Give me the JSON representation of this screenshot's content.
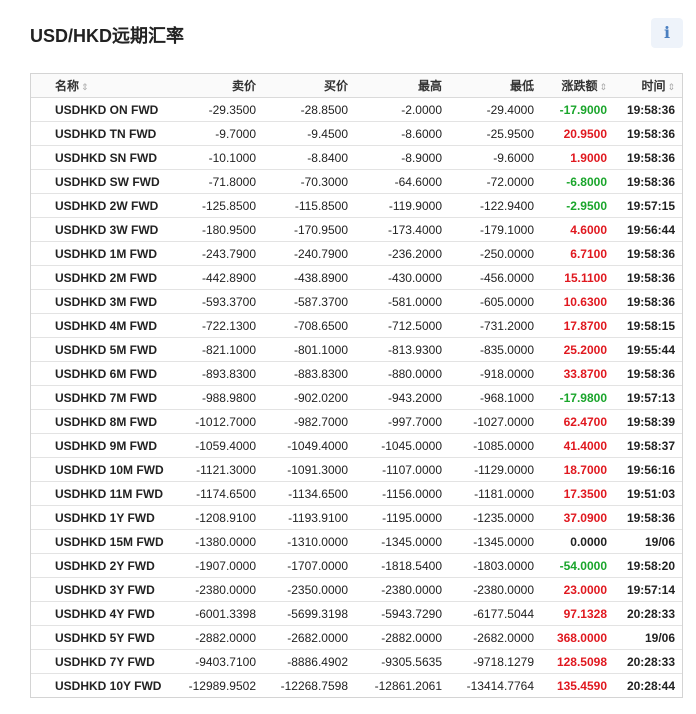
{
  "page": {
    "title": "USD/HKD远期汇率"
  },
  "header": {
    "columns": [
      "名称",
      "卖价",
      "买价",
      "最高",
      "最低",
      "涨跌额",
      "时间"
    ]
  },
  "icons": {
    "sort": "sort-updown-icon",
    "info": "info-icon"
  },
  "colors": {
    "up": "#e0181f",
    "down": "#1aa52b",
    "flat": "#222222"
  },
  "rows": [
    {
      "name": "USDHKD ON FWD",
      "ask": "-29.3500",
      "bid": "-28.8500",
      "high": "-2.0000",
      "low": "-29.4000",
      "change": "-17.9000",
      "dir": "down",
      "time": "19:58:36"
    },
    {
      "name": "USDHKD TN FWD",
      "ask": "-9.7000",
      "bid": "-9.4500",
      "high": "-8.6000",
      "low": "-25.9500",
      "change": "20.9500",
      "dir": "up",
      "time": "19:58:36"
    },
    {
      "name": "USDHKD SN FWD",
      "ask": "-10.1000",
      "bid": "-8.8400",
      "high": "-8.9000",
      "low": "-9.6000",
      "change": "1.9000",
      "dir": "up",
      "time": "19:58:36"
    },
    {
      "name": "USDHKD SW FWD",
      "ask": "-71.8000",
      "bid": "-70.3000",
      "high": "-64.6000",
      "low": "-72.0000",
      "change": "-6.8000",
      "dir": "down",
      "time": "19:58:36"
    },
    {
      "name": "USDHKD 2W FWD",
      "ask": "-125.8500",
      "bid": "-115.8500",
      "high": "-119.9000",
      "low": "-122.9400",
      "change": "-2.9500",
      "dir": "down",
      "time": "19:57:15"
    },
    {
      "name": "USDHKD 3W FWD",
      "ask": "-180.9500",
      "bid": "-170.9500",
      "high": "-173.4000",
      "low": "-179.1000",
      "change": "4.6000",
      "dir": "up",
      "time": "19:56:44"
    },
    {
      "name": "USDHKD 1M FWD",
      "ask": "-243.7900",
      "bid": "-240.7900",
      "high": "-236.2000",
      "low": "-250.0000",
      "change": "6.7100",
      "dir": "up",
      "time": "19:58:36"
    },
    {
      "name": "USDHKD 2M FWD",
      "ask": "-442.8900",
      "bid": "-438.8900",
      "high": "-430.0000",
      "low": "-456.0000",
      "change": "15.1100",
      "dir": "up",
      "time": "19:58:36"
    },
    {
      "name": "USDHKD 3M FWD",
      "ask": "-593.3700",
      "bid": "-587.3700",
      "high": "-581.0000",
      "low": "-605.0000",
      "change": "10.6300",
      "dir": "up",
      "time": "19:58:36"
    },
    {
      "name": "USDHKD 4M FWD",
      "ask": "-722.1300",
      "bid": "-708.6500",
      "high": "-712.5000",
      "low": "-731.2000",
      "change": "17.8700",
      "dir": "up",
      "time": "19:58:15"
    },
    {
      "name": "USDHKD 5M FWD",
      "ask": "-821.1000",
      "bid": "-801.1000",
      "high": "-813.9300",
      "low": "-835.0000",
      "change": "25.2000",
      "dir": "up",
      "time": "19:55:44"
    },
    {
      "name": "USDHKD 6M FWD",
      "ask": "-893.8300",
      "bid": "-883.8300",
      "high": "-880.0000",
      "low": "-918.0000",
      "change": "33.8700",
      "dir": "up",
      "time": "19:58:36"
    },
    {
      "name": "USDHKD 7M FWD",
      "ask": "-988.9800",
      "bid": "-902.0200",
      "high": "-943.2000",
      "low": "-968.1000",
      "change": "-17.9800",
      "dir": "down",
      "time": "19:57:13"
    },
    {
      "name": "USDHKD 8M FWD",
      "ask": "-1012.7000",
      "bid": "-982.7000",
      "high": "-997.7000",
      "low": "-1027.0000",
      "change": "62.4700",
      "dir": "up",
      "time": "19:58:39"
    },
    {
      "name": "USDHKD 9M FWD",
      "ask": "-1059.4000",
      "bid": "-1049.4000",
      "high": "-1045.0000",
      "low": "-1085.0000",
      "change": "41.4000",
      "dir": "up",
      "time": "19:58:37"
    },
    {
      "name": "USDHKD 10M FWD",
      "ask": "-1121.3000",
      "bid": "-1091.3000",
      "high": "-1107.0000",
      "low": "-1129.0000",
      "change": "18.7000",
      "dir": "up",
      "time": "19:56:16"
    },
    {
      "name": "USDHKD 11M FWD",
      "ask": "-1174.6500",
      "bid": "-1134.6500",
      "high": "-1156.0000",
      "low": "-1181.0000",
      "change": "17.3500",
      "dir": "up",
      "time": "19:51:03"
    },
    {
      "name": "USDHKD 1Y FWD",
      "ask": "-1208.9100",
      "bid": "-1193.9100",
      "high": "-1195.0000",
      "low": "-1235.0000",
      "change": "37.0900",
      "dir": "up",
      "time": "19:58:36"
    },
    {
      "name": "USDHKD 15M FWD",
      "ask": "-1380.0000",
      "bid": "-1310.0000",
      "high": "-1345.0000",
      "low": "-1345.0000",
      "change": "0.0000",
      "dir": "flat",
      "time": "19/06"
    },
    {
      "name": "USDHKD 2Y FWD",
      "ask": "-1907.0000",
      "bid": "-1707.0000",
      "high": "-1818.5400",
      "low": "-1803.0000",
      "change": "-54.0000",
      "dir": "down",
      "time": "19:58:20"
    },
    {
      "name": "USDHKD 3Y FWD",
      "ask": "-2380.0000",
      "bid": "-2350.0000",
      "high": "-2380.0000",
      "low": "-2380.0000",
      "change": "23.0000",
      "dir": "up",
      "time": "19:57:14"
    },
    {
      "name": "USDHKD 4Y FWD",
      "ask": "-6001.3398",
      "bid": "-5699.3198",
      "high": "-5943.7290",
      "low": "-6177.5044",
      "change": "97.1328",
      "dir": "up",
      "time": "20:28:33"
    },
    {
      "name": "USDHKD 5Y FWD",
      "ask": "-2882.0000",
      "bid": "-2682.0000",
      "high": "-2882.0000",
      "low": "-2682.0000",
      "change": "368.0000",
      "dir": "up",
      "time": "19/06"
    },
    {
      "name": "USDHKD 7Y FWD",
      "ask": "-9403.7100",
      "bid": "-8886.4902",
      "high": "-9305.5635",
      "low": "-9718.1279",
      "change": "128.5098",
      "dir": "up",
      "time": "20:28:33"
    },
    {
      "name": "USDHKD 10Y FWD",
      "ask": "-12989.9502",
      "bid": "-12268.7598",
      "high": "-12861.2061",
      "low": "-13414.7764",
      "change": "135.4590",
      "dir": "up",
      "time": "20:28:44"
    }
  ]
}
